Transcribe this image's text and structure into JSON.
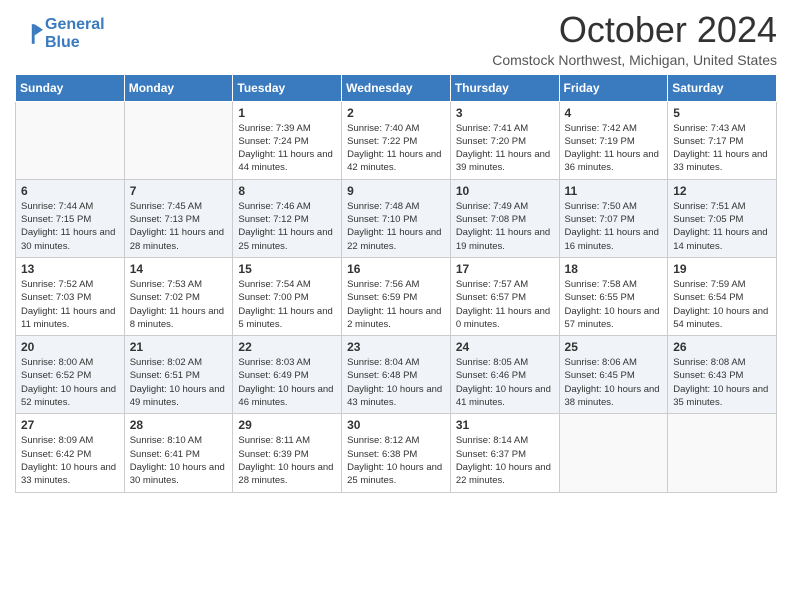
{
  "logo": {
    "line1": "General",
    "line2": "Blue"
  },
  "title": "October 2024",
  "subtitle": "Comstock Northwest, Michigan, United States",
  "days_of_week": [
    "Sunday",
    "Monday",
    "Tuesday",
    "Wednesday",
    "Thursday",
    "Friday",
    "Saturday"
  ],
  "weeks": [
    [
      {
        "day": "",
        "sunrise": "",
        "sunset": "",
        "daylight": ""
      },
      {
        "day": "",
        "sunrise": "",
        "sunset": "",
        "daylight": ""
      },
      {
        "day": "1",
        "sunrise": "Sunrise: 7:39 AM",
        "sunset": "Sunset: 7:24 PM",
        "daylight": "Daylight: 11 hours and 44 minutes."
      },
      {
        "day": "2",
        "sunrise": "Sunrise: 7:40 AM",
        "sunset": "Sunset: 7:22 PM",
        "daylight": "Daylight: 11 hours and 42 minutes."
      },
      {
        "day": "3",
        "sunrise": "Sunrise: 7:41 AM",
        "sunset": "Sunset: 7:20 PM",
        "daylight": "Daylight: 11 hours and 39 minutes."
      },
      {
        "day": "4",
        "sunrise": "Sunrise: 7:42 AM",
        "sunset": "Sunset: 7:19 PM",
        "daylight": "Daylight: 11 hours and 36 minutes."
      },
      {
        "day": "5",
        "sunrise": "Sunrise: 7:43 AM",
        "sunset": "Sunset: 7:17 PM",
        "daylight": "Daylight: 11 hours and 33 minutes."
      }
    ],
    [
      {
        "day": "6",
        "sunrise": "Sunrise: 7:44 AM",
        "sunset": "Sunset: 7:15 PM",
        "daylight": "Daylight: 11 hours and 30 minutes."
      },
      {
        "day": "7",
        "sunrise": "Sunrise: 7:45 AM",
        "sunset": "Sunset: 7:13 PM",
        "daylight": "Daylight: 11 hours and 28 minutes."
      },
      {
        "day": "8",
        "sunrise": "Sunrise: 7:46 AM",
        "sunset": "Sunset: 7:12 PM",
        "daylight": "Daylight: 11 hours and 25 minutes."
      },
      {
        "day": "9",
        "sunrise": "Sunrise: 7:48 AM",
        "sunset": "Sunset: 7:10 PM",
        "daylight": "Daylight: 11 hours and 22 minutes."
      },
      {
        "day": "10",
        "sunrise": "Sunrise: 7:49 AM",
        "sunset": "Sunset: 7:08 PM",
        "daylight": "Daylight: 11 hours and 19 minutes."
      },
      {
        "day": "11",
        "sunrise": "Sunrise: 7:50 AM",
        "sunset": "Sunset: 7:07 PM",
        "daylight": "Daylight: 11 hours and 16 minutes."
      },
      {
        "day": "12",
        "sunrise": "Sunrise: 7:51 AM",
        "sunset": "Sunset: 7:05 PM",
        "daylight": "Daylight: 11 hours and 14 minutes."
      }
    ],
    [
      {
        "day": "13",
        "sunrise": "Sunrise: 7:52 AM",
        "sunset": "Sunset: 7:03 PM",
        "daylight": "Daylight: 11 hours and 11 minutes."
      },
      {
        "day": "14",
        "sunrise": "Sunrise: 7:53 AM",
        "sunset": "Sunset: 7:02 PM",
        "daylight": "Daylight: 11 hours and 8 minutes."
      },
      {
        "day": "15",
        "sunrise": "Sunrise: 7:54 AM",
        "sunset": "Sunset: 7:00 PM",
        "daylight": "Daylight: 11 hours and 5 minutes."
      },
      {
        "day": "16",
        "sunrise": "Sunrise: 7:56 AM",
        "sunset": "Sunset: 6:59 PM",
        "daylight": "Daylight: 11 hours and 2 minutes."
      },
      {
        "day": "17",
        "sunrise": "Sunrise: 7:57 AM",
        "sunset": "Sunset: 6:57 PM",
        "daylight": "Daylight: 11 hours and 0 minutes."
      },
      {
        "day": "18",
        "sunrise": "Sunrise: 7:58 AM",
        "sunset": "Sunset: 6:55 PM",
        "daylight": "Daylight: 10 hours and 57 minutes."
      },
      {
        "day": "19",
        "sunrise": "Sunrise: 7:59 AM",
        "sunset": "Sunset: 6:54 PM",
        "daylight": "Daylight: 10 hours and 54 minutes."
      }
    ],
    [
      {
        "day": "20",
        "sunrise": "Sunrise: 8:00 AM",
        "sunset": "Sunset: 6:52 PM",
        "daylight": "Daylight: 10 hours and 52 minutes."
      },
      {
        "day": "21",
        "sunrise": "Sunrise: 8:02 AM",
        "sunset": "Sunset: 6:51 PM",
        "daylight": "Daylight: 10 hours and 49 minutes."
      },
      {
        "day": "22",
        "sunrise": "Sunrise: 8:03 AM",
        "sunset": "Sunset: 6:49 PM",
        "daylight": "Daylight: 10 hours and 46 minutes."
      },
      {
        "day": "23",
        "sunrise": "Sunrise: 8:04 AM",
        "sunset": "Sunset: 6:48 PM",
        "daylight": "Daylight: 10 hours and 43 minutes."
      },
      {
        "day": "24",
        "sunrise": "Sunrise: 8:05 AM",
        "sunset": "Sunset: 6:46 PM",
        "daylight": "Daylight: 10 hours and 41 minutes."
      },
      {
        "day": "25",
        "sunrise": "Sunrise: 8:06 AM",
        "sunset": "Sunset: 6:45 PM",
        "daylight": "Daylight: 10 hours and 38 minutes."
      },
      {
        "day": "26",
        "sunrise": "Sunrise: 8:08 AM",
        "sunset": "Sunset: 6:43 PM",
        "daylight": "Daylight: 10 hours and 35 minutes."
      }
    ],
    [
      {
        "day": "27",
        "sunrise": "Sunrise: 8:09 AM",
        "sunset": "Sunset: 6:42 PM",
        "daylight": "Daylight: 10 hours and 33 minutes."
      },
      {
        "day": "28",
        "sunrise": "Sunrise: 8:10 AM",
        "sunset": "Sunset: 6:41 PM",
        "daylight": "Daylight: 10 hours and 30 minutes."
      },
      {
        "day": "29",
        "sunrise": "Sunrise: 8:11 AM",
        "sunset": "Sunset: 6:39 PM",
        "daylight": "Daylight: 10 hours and 28 minutes."
      },
      {
        "day": "30",
        "sunrise": "Sunrise: 8:12 AM",
        "sunset": "Sunset: 6:38 PM",
        "daylight": "Daylight: 10 hours and 25 minutes."
      },
      {
        "day": "31",
        "sunrise": "Sunrise: 8:14 AM",
        "sunset": "Sunset: 6:37 PM",
        "daylight": "Daylight: 10 hours and 22 minutes."
      },
      {
        "day": "",
        "sunrise": "",
        "sunset": "",
        "daylight": ""
      },
      {
        "day": "",
        "sunrise": "",
        "sunset": "",
        "daylight": ""
      }
    ]
  ]
}
